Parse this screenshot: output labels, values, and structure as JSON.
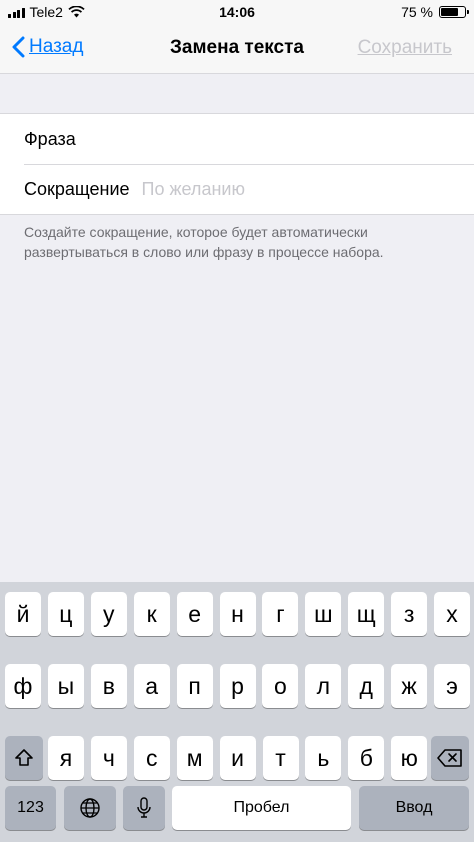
{
  "status_bar": {
    "carrier": "Tele2",
    "time": "14:06",
    "battery_percent": "75 %",
    "battery_level": 0.75
  },
  "nav": {
    "back_label": "Назад",
    "title": "Замена текста",
    "save_label": "Сохранить"
  },
  "form": {
    "phrase_label": "Фраза",
    "shortcut_label": "Сокращение",
    "shortcut_placeholder": "По желанию",
    "footer": "Создайте сокращение, которое будет автоматически развертываться в слово или фразу в процессе набора."
  },
  "keyboard": {
    "row1": [
      "й",
      "ц",
      "у",
      "к",
      "е",
      "н",
      "г",
      "ш",
      "щ",
      "з",
      "х"
    ],
    "row2": [
      "ф",
      "ы",
      "в",
      "а",
      "п",
      "р",
      "о",
      "л",
      "д",
      "ж",
      "э"
    ],
    "row3": [
      "я",
      "ч",
      "с",
      "м",
      "и",
      "т",
      "ь",
      "б",
      "ю"
    ],
    "numbers_label": "123",
    "space_label": "Пробел",
    "return_label": "Ввод",
    "shift_icon": "shift-icon",
    "delete_icon": "delete-icon",
    "globe_icon": "globe-icon",
    "mic_icon": "microphone-icon"
  }
}
